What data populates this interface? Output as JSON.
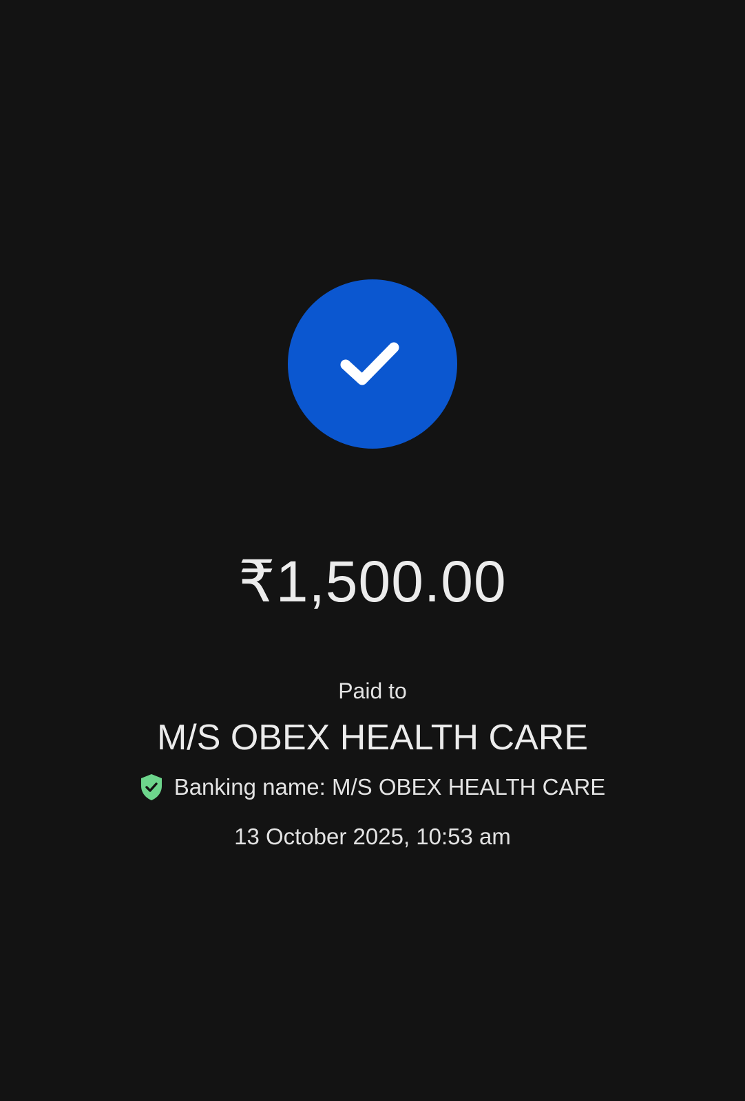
{
  "payment": {
    "status_icon": "check-icon",
    "amount": "₹1,500.00",
    "paid_to_label": "Paid to",
    "payee_name": "M/S OBEX HEALTH CARE",
    "verified_icon": "shield-check-icon",
    "banking_name": "Banking name: M/S OBEX HEALTH CARE",
    "timestamp": "13 October 2025, 10:53 am"
  },
  "colors": {
    "background": "#131313",
    "success_circle": "#0b57d0",
    "verified_shield": "#6dd58c",
    "text": "#e3e3e3"
  }
}
